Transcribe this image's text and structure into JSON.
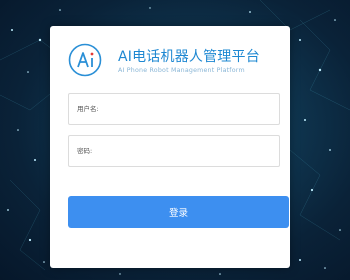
{
  "app": {
    "logo_text": "Ai",
    "title": "AI电话机器人管理平台",
    "subtitle": "AI Phone Robot Management Platform"
  },
  "form": {
    "username_placeholder": "用户名:",
    "username_value": "",
    "password_placeholder": "密码:",
    "password_value": "",
    "login_label": "登录"
  },
  "colors": {
    "accent": "#3d8ff0",
    "title": "#1e88d2",
    "background_dark": "#0a2238"
  },
  "icons": [
    "ai-logo-icon"
  ]
}
